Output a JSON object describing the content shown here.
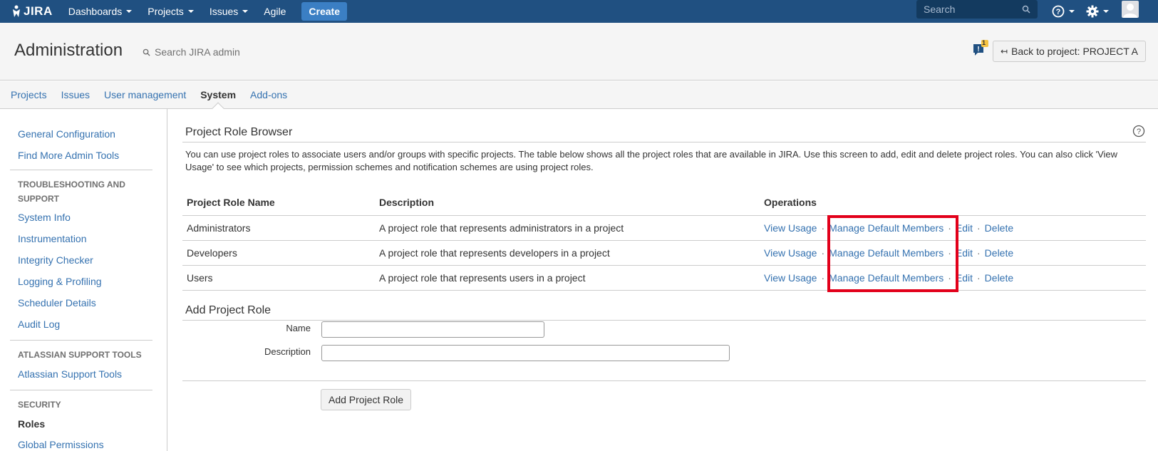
{
  "topnav": {
    "logo_text": "JIRA",
    "items": [
      {
        "label": "Dashboards"
      },
      {
        "label": "Projects"
      },
      {
        "label": "Issues"
      },
      {
        "label": "Agile"
      }
    ],
    "create_label": "Create",
    "search_placeholder": "Search",
    "icons": [
      "help-icon",
      "gear-icon",
      "avatar"
    ]
  },
  "header": {
    "title": "Administration",
    "search_placeholder": "Search JIRA admin",
    "feedback_badge": "1",
    "back_button": "Back to project: PROJECT A"
  },
  "tabs": [
    {
      "label": "Projects",
      "active": false
    },
    {
      "label": "Issues",
      "active": false
    },
    {
      "label": "User management",
      "active": false
    },
    {
      "label": "System",
      "active": true
    },
    {
      "label": "Add-ons",
      "active": false
    }
  ],
  "sidebar": {
    "group0": {
      "links": [
        "General Configuration",
        "Find More Admin Tools"
      ]
    },
    "group1": {
      "heading": "TROUBLESHOOTING AND SUPPORT",
      "links": [
        "System Info",
        "Instrumentation",
        "Integrity Checker",
        "Logging & Profiling",
        "Scheduler Details",
        "Audit Log"
      ]
    },
    "group2": {
      "heading": "ATLASSIAN SUPPORT TOOLS",
      "links": [
        "Atlassian Support Tools"
      ]
    },
    "group3": {
      "heading": "SECURITY",
      "links": [
        "Roles",
        "Global Permissions"
      ]
    }
  },
  "main": {
    "title": "Project Role Browser",
    "intro": "You can use project roles to associate users and/or groups with specific projects. The table below shows all the project roles that are available in JIRA. Use this screen to add, edit and delete project roles. You can also click 'View Usage' to see which projects, permission schemes and notification schemes are using project roles.",
    "table": {
      "headers": [
        "Project Role Name",
        "Description",
        "Operations"
      ],
      "rows": [
        {
          "name": "Administrators",
          "description": "A project role that represents administrators in a project"
        },
        {
          "name": "Developers",
          "description": "A project role that represents developers in a project"
        },
        {
          "name": "Users",
          "description": "A project role that represents users in a project"
        }
      ],
      "ops": {
        "view_usage": "View Usage",
        "manage": "Manage Default Members",
        "edit": "Edit",
        "delete": "Delete",
        "separator": "·"
      }
    },
    "add_form": {
      "title": "Add Project Role",
      "name_label": "Name",
      "name_value": "",
      "description_label": "Description",
      "description_value": "",
      "submit_label": "Add Project Role"
    }
  }
}
